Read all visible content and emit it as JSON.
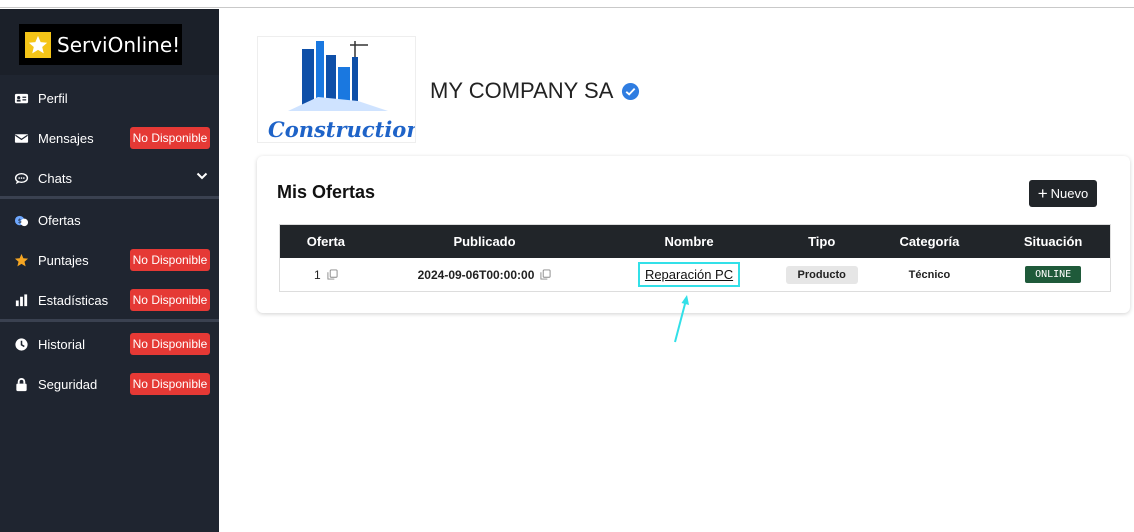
{
  "brand": {
    "name": "ServiOnline!",
    "icon": "star-icon"
  },
  "sidebar": {
    "items": [
      {
        "label": "Perfil",
        "icon": "id-card-icon",
        "badge": ""
      },
      {
        "label": "Mensajes",
        "icon": "envelope-icon",
        "badge": "No Disponible"
      },
      {
        "label": "Chats",
        "icon": "chat-icon",
        "badge": ""
      },
      {
        "label": "Ofertas",
        "icon": "money-icon",
        "badge": ""
      },
      {
        "label": "Puntajes",
        "icon": "star-icon",
        "badge": "No Disponible"
      },
      {
        "label": "Estadísticas",
        "icon": "bar-chart-icon",
        "badge": "No Disponible"
      },
      {
        "label": "Historial",
        "icon": "clock-icon",
        "badge": "No Disponible"
      },
      {
        "label": "Seguridad",
        "icon": "lock-icon",
        "badge": "No Disponible"
      }
    ]
  },
  "company": {
    "name": "MY COMPANY SA",
    "logo_text": "Construction",
    "verified_icon": "check-badge-icon"
  },
  "offers": {
    "title": "Mis Ofertas",
    "new_button": "Nuevo",
    "columns": [
      "Oferta",
      "Publicado",
      "Nombre",
      "Tipo",
      "Categoría",
      "Situación"
    ],
    "rows": [
      {
        "oferta": "1",
        "publicado": "2024-09-06T00:00:00",
        "nombre": "Reparación PC",
        "tipo": "Producto",
        "categoria": "Técnico",
        "situacion": "ONLINE"
      }
    ]
  },
  "colors": {
    "sidebar_bg": "#1f2530",
    "badge_red": "#e53935",
    "status_green": "#1f5a3a",
    "highlight_cyan": "#32e0e8",
    "accent_blue": "#1e63c8"
  }
}
